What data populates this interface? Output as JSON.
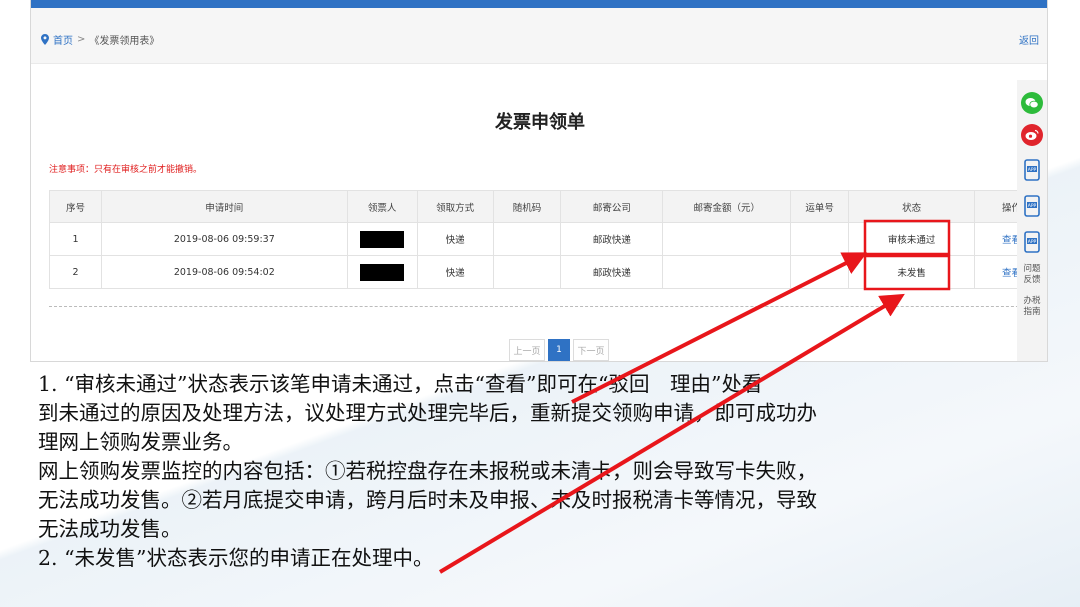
{
  "breadcrumb": {
    "home": "首页",
    "separator": ">",
    "current": "《发票领用表》"
  },
  "back_link": "返回",
  "page_title": "发票申领单",
  "notice": "注意事项：只有在审核之前才能撤销。",
  "table": {
    "headers": [
      "序号",
      "申请时间",
      "领票人",
      "领取方式",
      "随机码",
      "邮寄公司",
      "邮寄金额（元）",
      "运单号",
      "状态",
      "操作"
    ],
    "rows": [
      {
        "index": "1",
        "time": "2019-08-06 09:59:37",
        "method": "快递",
        "random_code": "",
        "courier": "邮政快递",
        "amount": "",
        "waybill": "",
        "status": "审核未通过",
        "action": "查看"
      },
      {
        "index": "2",
        "time": "2019-08-06 09:54:02",
        "method": "快递",
        "random_code": "",
        "courier": "邮政快递",
        "amount": "",
        "waybill": "",
        "status": "未发售",
        "action": "查看"
      }
    ]
  },
  "pager": {
    "prev": "上一页",
    "current": "1",
    "next": "下一页"
  },
  "side_rail": {
    "items": [
      "wechat-icon",
      "weibo-icon",
      "app-icon",
      "app-icon",
      "app-icon"
    ],
    "feedback": "问题反馈",
    "guide": "办税指南"
  },
  "colors": {
    "accent": "#2f72c4",
    "highlight": "#e8161b",
    "notice": "#e02020"
  },
  "body_text": {
    "line1": "1. “审核未通过”状态表示该笔申请未通过，点击“查看”即可在“驳回　理由”处看",
    "line2": "到未通过的原因及处理方法，议处理方式处理完毕后，重新提交领购申请，即可成功办",
    "line3": "理网上领购发票业务。",
    "line4": "网上领购发票监控的内容包括：①若税控盘存在未报税或未清卡，则会导致写卡失败，",
    "line5": "无法成功发售。②若月底提交申请，跨月后时未及申报、未及时报税清卡等情况，导致",
    "line6": "无法成功发售。",
    "line7": "2. “未发售”状态表示您的申请正在处理中。"
  }
}
